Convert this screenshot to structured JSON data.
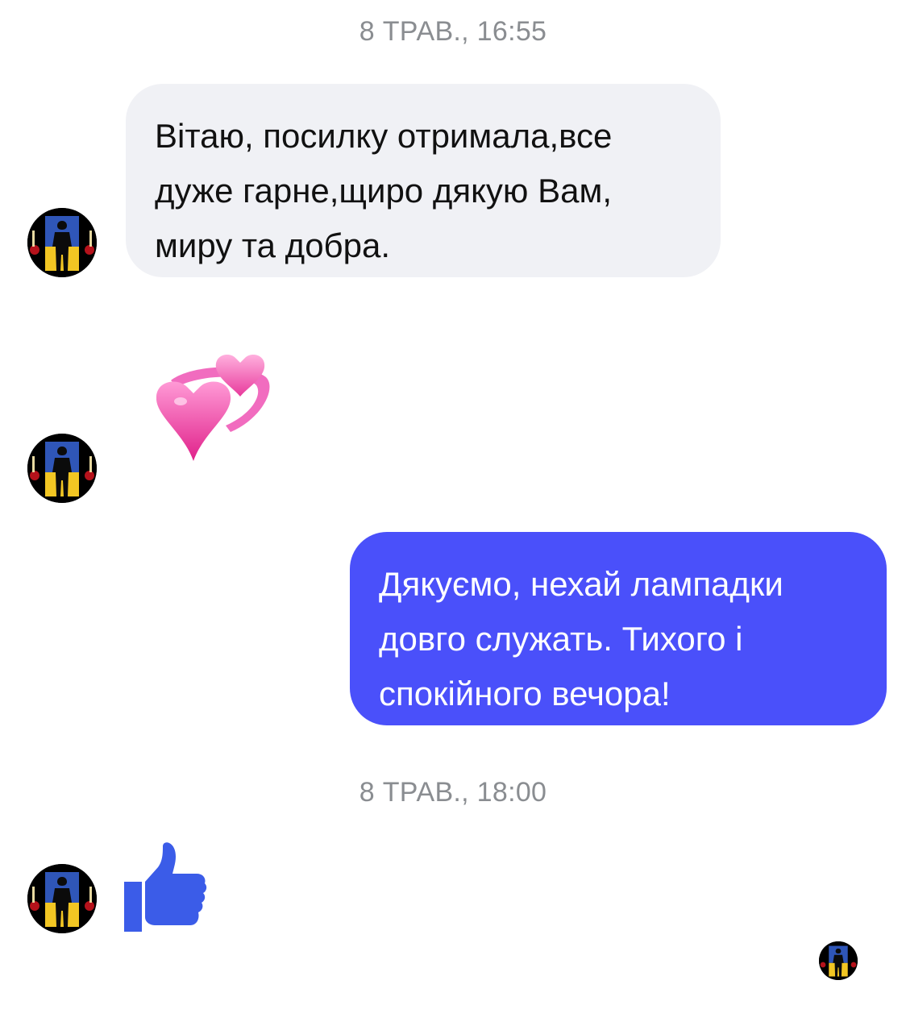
{
  "conversation": {
    "timestamps": [
      "8 ТРАВ., 16:55",
      "8 ТРАВ., 18:00"
    ],
    "messages": [
      {
        "sender": "contact",
        "text": "Вітаю, посилку отримала,все дуже гарне,щиро дякую Вам, миру та добра."
      },
      {
        "sender": "contact",
        "emoji": "revolving-hearts"
      },
      {
        "sender": "me",
        "text": "Дякуємо, нехай лампадки довго служать. Тихого і спокійного вечора!"
      },
      {
        "sender": "contact",
        "emoji": "thumbs-up"
      }
    ]
  },
  "colors": {
    "incoming_bubble": "#f0f1f5",
    "outgoing_bubble": "#4a50fa",
    "like": "#3b5ce8",
    "timestamp": "#8a8d91"
  },
  "icons": {
    "avatar": "soldier-silhouette-avatar",
    "hearts": "revolving-hearts-icon",
    "like": "thumbs-up-icon"
  }
}
